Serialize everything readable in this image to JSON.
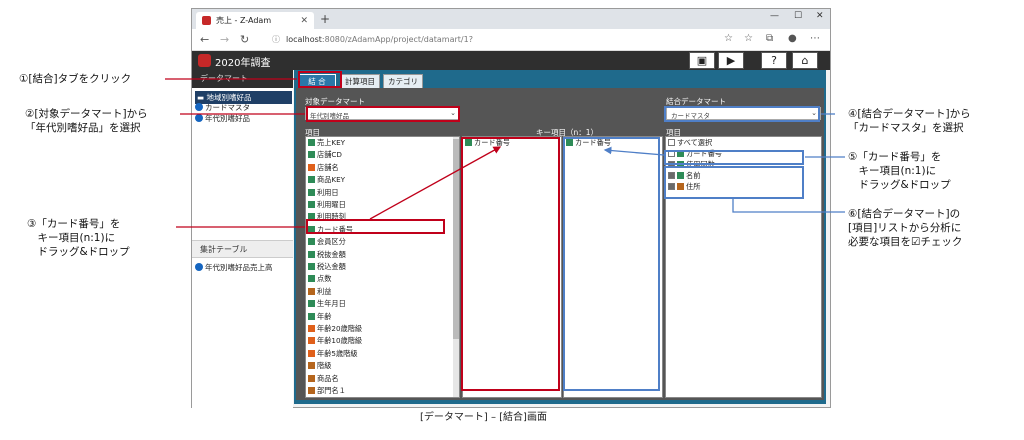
{
  "browser": {
    "tab_title": "売上 - Z-Adam",
    "url_host": "localhost",
    "url_rest": ":8080/zAdamApp/project/datamart/1?"
  },
  "app": {
    "title": "2020年調査"
  },
  "sidebar": {
    "datamart_header": "データマート",
    "datamart_items": [
      "地域別嗜好品",
      "カードマスタ",
      "年代別嗜好品"
    ],
    "aggregate_header": "集計テーブル",
    "aggregate_items": [
      "年代別嗜好品売上高"
    ]
  },
  "tabs": [
    "結 合",
    "計算項目",
    "カテゴリ"
  ],
  "target": {
    "label": "対象データマート",
    "selected": "年代別嗜好品",
    "items_label": "項目",
    "items": [
      {
        "text": "売上KEY",
        "icon": "g"
      },
      {
        "text": "店舗CD",
        "icon": "g"
      },
      {
        "text": "店舗名",
        "icon": "o"
      },
      {
        "text": "商品KEY",
        "icon": "g"
      },
      {
        "text": "利用日",
        "icon": "g"
      },
      {
        "text": "利用曜日",
        "icon": "g"
      },
      {
        "text": "利用時刻",
        "icon": "g"
      },
      {
        "text": "カード番号",
        "icon": "g"
      },
      {
        "text": "会員区分",
        "icon": "g"
      },
      {
        "text": "税抜金額",
        "icon": "g"
      },
      {
        "text": "税込金額",
        "icon": "g"
      },
      {
        "text": "点数",
        "icon": "g"
      },
      {
        "text": "利益",
        "icon": "br"
      },
      {
        "text": "生年月日",
        "icon": "g"
      },
      {
        "text": "年齢",
        "icon": "g"
      },
      {
        "text": "年齢20歳階級",
        "icon": "o"
      },
      {
        "text": "年齢10歳階級",
        "icon": "o"
      },
      {
        "text": "年齢5歳階級",
        "icon": "o"
      },
      {
        "text": "階級",
        "icon": "br"
      },
      {
        "text": "商品名",
        "icon": "br"
      },
      {
        "text": "部門名１",
        "icon": "br"
      }
    ]
  },
  "key": {
    "label": "キー項目（n：1）",
    "left": "カード番号",
    "right": "カード番号"
  },
  "join": {
    "label": "結合データマート",
    "selected": "カードマスタ",
    "items_label": "項目",
    "select_all": "すべて選択",
    "items": [
      "カード番号",
      "使用回数",
      "名前",
      "住所"
    ]
  },
  "callouts": {
    "c1": "①[結合]タブをクリック",
    "c2": "②[対象データマート]から\n「年代別嗜好品」を選択",
    "c3": "③「カード番号」を\n　キー項目(n:1)に\n　ドラッグ&ドロップ",
    "c4": "④[結合データマート]から\n「カードマスタ」を選択",
    "c5": "⑤「カード番号」を\n　キー項目(n:1)に\n　ドラッグ&ドロップ",
    "c6": "⑥[結合データマート]の\n[項目]リストから分析に\n必要な項目を☑チェック"
  },
  "caption": "[データマート] – [結合]画面"
}
